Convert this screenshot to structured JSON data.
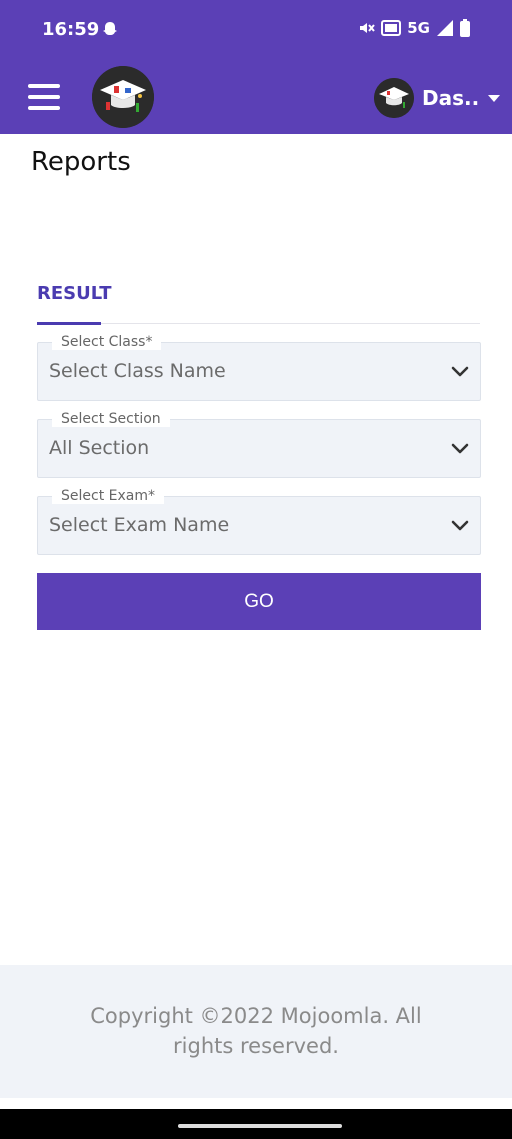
{
  "status_bar": {
    "time": "16:59",
    "network": "5G",
    "icons": [
      "snapchat-icon",
      "mute-icon",
      "volte-icon",
      "signal-icon",
      "battery-icon"
    ]
  },
  "app_bar": {
    "user_name": "Das...",
    "icons": [
      "hamburger-menu-icon",
      "school-logo",
      "avatar",
      "caret-down-icon"
    ],
    "accent_color": "#5b40b6"
  },
  "page": {
    "title": "Reports"
  },
  "tabs": [
    {
      "label": "RESULT",
      "active": true
    }
  ],
  "form": {
    "class_field": {
      "label": "Select Class*",
      "value": "Select Class Name"
    },
    "section_field": {
      "label": "Select Section",
      "value": "All Section"
    },
    "exam_field": {
      "label": "Select Exam*",
      "value": "Select Exam Name"
    },
    "go_label": "GO"
  },
  "footer": {
    "copyright_line1": "Copyright ©2022 Mojoomla. All",
    "copyright_line2": "rights reserved."
  }
}
